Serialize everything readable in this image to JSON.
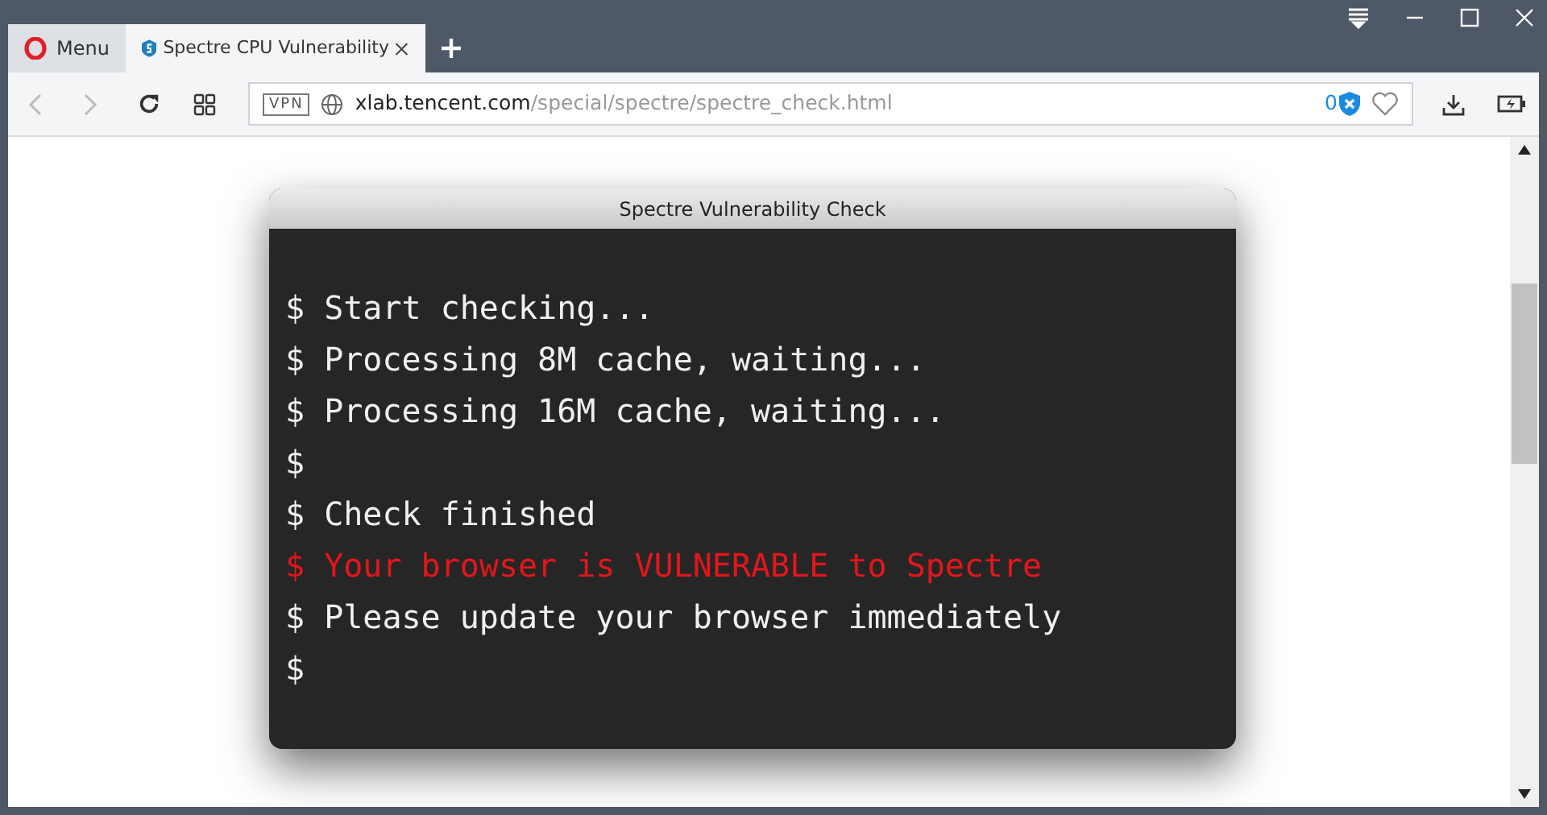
{
  "tabs": [
    {
      "label": "Menu",
      "kind": "menu",
      "selected": false
    },
    {
      "label": "Spectre CPU Vulnerability",
      "kind": "page",
      "selected": true
    }
  ],
  "address_bar": {
    "vpn": "VPN",
    "host": "xlab.tencent.com",
    "path": "/special/spectre/spectre_check.html",
    "blocked_count": "0"
  },
  "terminal": {
    "title": "Spectre Vulnerability Check",
    "lines": [
      {
        "text": "$ Start checking...",
        "kind": "normal"
      },
      {
        "text": "$ Processing 8M cache, waiting...",
        "kind": "normal"
      },
      {
        "text": "$ Processing 16M cache, waiting...",
        "kind": "normal"
      },
      {
        "text": "$",
        "kind": "normal"
      },
      {
        "text": "$ Check finished",
        "kind": "normal"
      },
      {
        "text": "$ Your browser is VULNERABLE to Spectre",
        "kind": "alert"
      },
      {
        "text": "$ Please update your browser immediately",
        "kind": "normal"
      },
      {
        "text": "$",
        "kind": "normal"
      }
    ]
  }
}
